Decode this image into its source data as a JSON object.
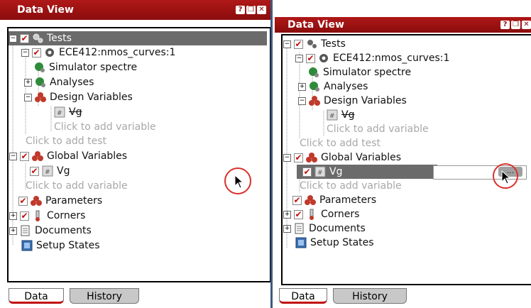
{
  "panel_left": {
    "title": "Data View",
    "tabs": [
      "Data",
      "History"
    ]
  },
  "panel_right": {
    "title": "Data View",
    "tabs": [
      "Data",
      "History"
    ],
    "edit_button_label": "..."
  },
  "tree": {
    "tests": "Tests",
    "test_name": "ECE412:nmos_curves:1",
    "simulator": "Simulator  spectre",
    "analyses": "Analyses",
    "design_variables": "Design Variables",
    "design_var_vg": "Vg",
    "click_add_variable": "Click to add variable",
    "click_add_test": "Click to add test",
    "global_variables": "Global Variables",
    "global_var_vg": "Vg",
    "click_add_global_variable": "Click to add variable",
    "parameters": "Parameters",
    "corners": "Corners",
    "documents": "Documents",
    "setup_states": "Setup States"
  },
  "colors": {
    "title_bar": "#a01414",
    "check_mark": "#c01010",
    "selection_row": "#6b6b6b",
    "highlight_circle": "#d9302a"
  }
}
